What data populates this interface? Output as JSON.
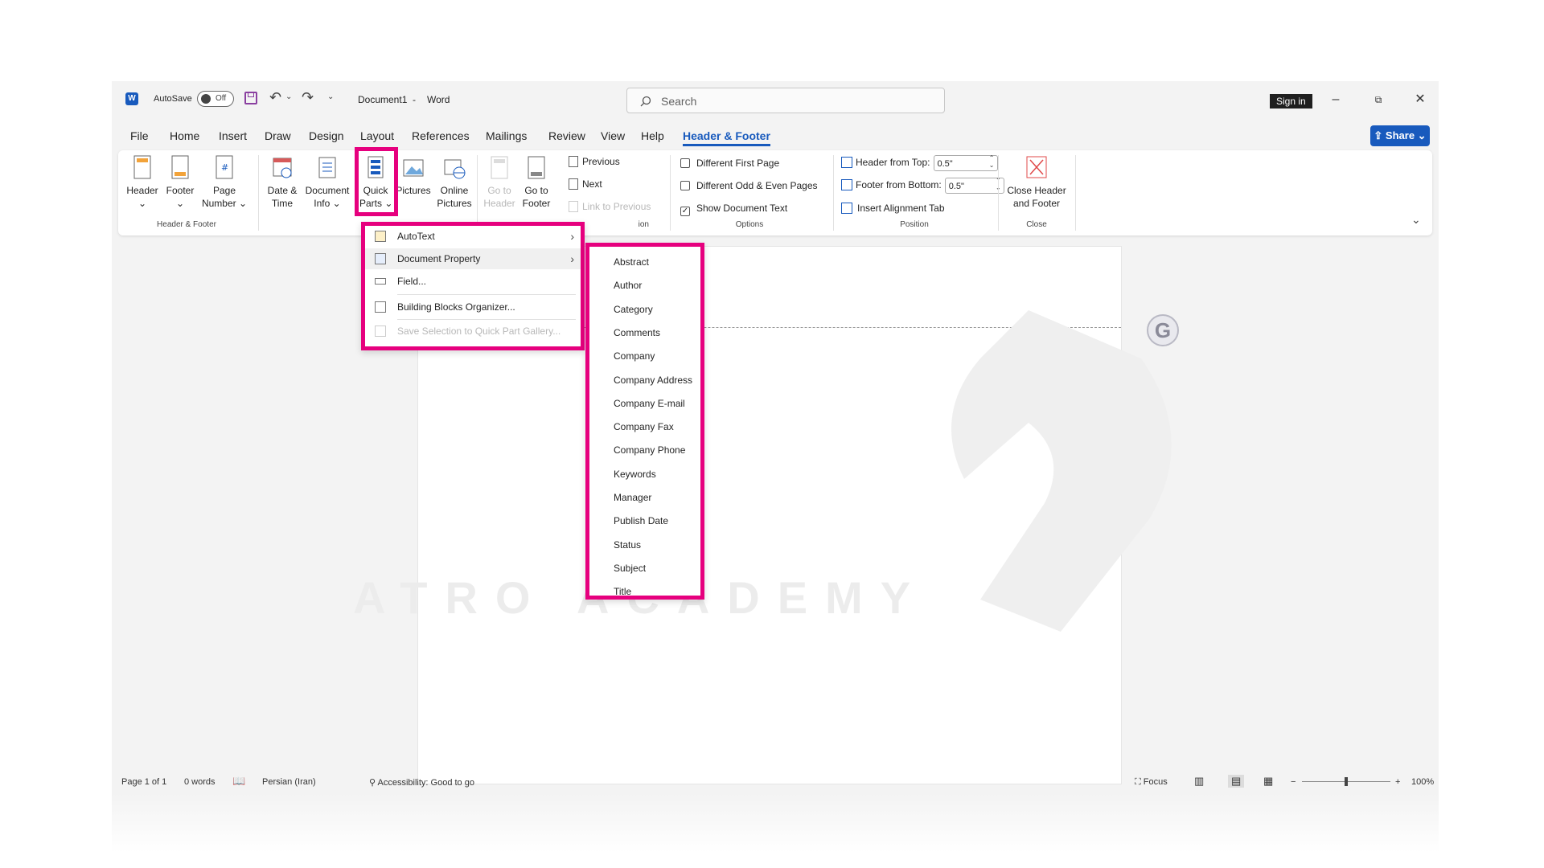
{
  "title_bar": {
    "autosave_label": "AutoSave",
    "autosave_state": "Off",
    "doc_title": "Document1",
    "sep": "-",
    "app_name": "Word",
    "search_placeholder": "Search",
    "sign_in": "Sign in"
  },
  "menu_tabs": [
    "File",
    "Home",
    "Insert",
    "Draw",
    "Design",
    "Layout",
    "References",
    "Mailings",
    "Review",
    "View",
    "Help",
    "Header & Footer"
  ],
  "share_label": "Share",
  "ribbon": {
    "header_label": "Header",
    "footer_label": "Footer",
    "page_number_label1": "Page",
    "page_number_label2": "Number",
    "group_header_footer": "Header & Footer",
    "date_time_1": "Date &",
    "date_time_2": "Time",
    "doc_info_1": "Document",
    "doc_info_2": "Info",
    "quick_parts_1": "Quick",
    "quick_parts_2": "Parts",
    "pictures": "Pictures",
    "online_pictures_1": "Online",
    "online_pictures_2": "Pictures",
    "goto_header_1": "Go to",
    "goto_header_2": "Header",
    "goto_footer_1": "Go to",
    "goto_footer_2": "Footer",
    "previous": "Previous",
    "next": "Next",
    "link_prev": "Link to Previous",
    "group_nav_partial": "ion",
    "diff_first": "Different First Page",
    "diff_odd_even": "Different Odd & Even Pages",
    "show_doc_text": "Show Document Text",
    "group_options": "Options",
    "header_from_top": "Header from Top:",
    "header_from_top_val": "0.5\"",
    "footer_from_bottom": "Footer from Bottom:",
    "footer_from_bottom_val": "0.5\"",
    "insert_align_tab": "Insert Alignment Tab",
    "group_position": "Position",
    "close_hf_1": "Close Header",
    "close_hf_2": "and Footer",
    "group_close": "Close"
  },
  "quick_parts_menu": {
    "autotext": "AutoText",
    "doc_property": "Document Property",
    "field": "Field...",
    "bb_organizer": "Building Blocks Organizer...",
    "save_selection": "Save Selection to Quick Part Gallery..."
  },
  "doc_property_items": [
    "Abstract",
    "Author",
    "Category",
    "Comments",
    "Company",
    "Company Address",
    "Company E-mail",
    "Company Fax",
    "Company Phone",
    "Keywords",
    "Manager",
    "Publish Date",
    "Status",
    "Subject",
    "Title"
  ],
  "watermark_text": "ATRO ACADEMY",
  "status_bar": {
    "page": "Page 1 of 1",
    "words": "0 words",
    "language": "Persian (Iran)",
    "accessibility": "Accessibility: Good to go",
    "focus": "Focus",
    "zoom": "100%"
  },
  "colors": {
    "accent": "#185abd",
    "highlight": "#e6007e"
  }
}
